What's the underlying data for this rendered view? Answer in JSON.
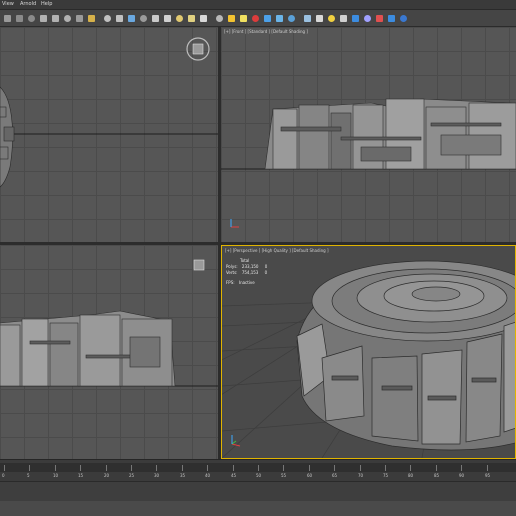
{
  "menu": [
    "View",
    "Arnold",
    "Help"
  ],
  "toolbar_icons": [
    {
      "name": "select-icon",
      "color": "#9a9a9a"
    },
    {
      "name": "select-region-icon",
      "color": "#8a8a8a"
    },
    {
      "name": "window-crossing-icon",
      "color": "#8a8a8a"
    },
    {
      "name": "move-icon",
      "color": "#b0b0b0"
    },
    {
      "name": "rotate-icon",
      "color": "#b0b0b0"
    },
    {
      "name": "scale-icon",
      "color": "#b0b0b0"
    },
    {
      "name": "link-icon",
      "color": "#9a9a9a"
    },
    {
      "name": "snap-icon",
      "color": "#d6b14a"
    },
    {
      "name": "angle-snap-icon",
      "color": "#c0c0c0"
    },
    {
      "name": "percent-snap-icon",
      "color": "#c0c0c0"
    },
    {
      "name": "mirror-icon",
      "color": "#6aa8e0"
    },
    {
      "name": "align-icon",
      "color": "#9a9a9a"
    },
    {
      "name": "layer-icon",
      "color": "#c9c9c9"
    },
    {
      "name": "material-editor-icon",
      "color": "#d0d0d0"
    },
    {
      "name": "render-setup-icon",
      "color": "#e0c870"
    },
    {
      "name": "render-frame-icon",
      "color": "#e0d080"
    },
    {
      "name": "render-icon",
      "color": "#d8d8d8"
    },
    {
      "name": "teapot-icon",
      "color": "#b8b8b8"
    },
    {
      "name": "sun-icon",
      "color": "#f2c230"
    },
    {
      "name": "light-icon",
      "color": "#f0e060"
    },
    {
      "name": "target-icon",
      "color": "#dc3c3c"
    },
    {
      "name": "arrow-icon",
      "color": "#4ca0e8"
    },
    {
      "name": "sphere-icon",
      "color": "#6ab4e8"
    },
    {
      "name": "globe-icon",
      "color": "#5aa0d8"
    },
    {
      "name": "grid-icon",
      "color": "#9ac0e0"
    },
    {
      "name": "cube-icon",
      "color": "#d8d8d8"
    },
    {
      "name": "bulb-icon",
      "color": "#f0d040"
    },
    {
      "name": "camera-icon",
      "color": "#cfcfcf"
    },
    {
      "name": "helper-icon",
      "color": "#3c8ce0"
    },
    {
      "name": "space-warp-icon",
      "color": "#a0a0ff"
    },
    {
      "name": "systems-icon",
      "color": "#e05050"
    },
    {
      "name": "scene-icon",
      "color": "#3c8ce0"
    },
    {
      "name": "plugin-icon",
      "color": "#3a78d0"
    }
  ],
  "viewports": {
    "top_left": {
      "label": ""
    },
    "top_right": {
      "label": "[+] [Front ] [Standard ] [Default Shading ]"
    },
    "bottom_left": {
      "label": ""
    },
    "bottom_right": {
      "label": "[+] [Perspective ] [High Quality ] [Default Shading ]"
    }
  },
  "stats": {
    "header": "Total",
    "polys_label": "Polys:",
    "polys_value": "233,150",
    "polys_sel": "0",
    "verts_label": "Verts:",
    "verts_value": "754,153",
    "verts_sel": "0",
    "fps_label": "FPS:",
    "fps_value": "Inactive"
  },
  "timeline": {
    "ticks": [
      "0",
      "5",
      "10",
      "15",
      "20",
      "25",
      "30",
      "35",
      "40",
      "45",
      "50",
      "55",
      "60",
      "65",
      "70",
      "75",
      "80",
      "85",
      "90",
      "95"
    ]
  },
  "colors": {
    "viewport_bg": "#565656",
    "active_border": "#e0b400",
    "model": "#8c8c8c"
  }
}
